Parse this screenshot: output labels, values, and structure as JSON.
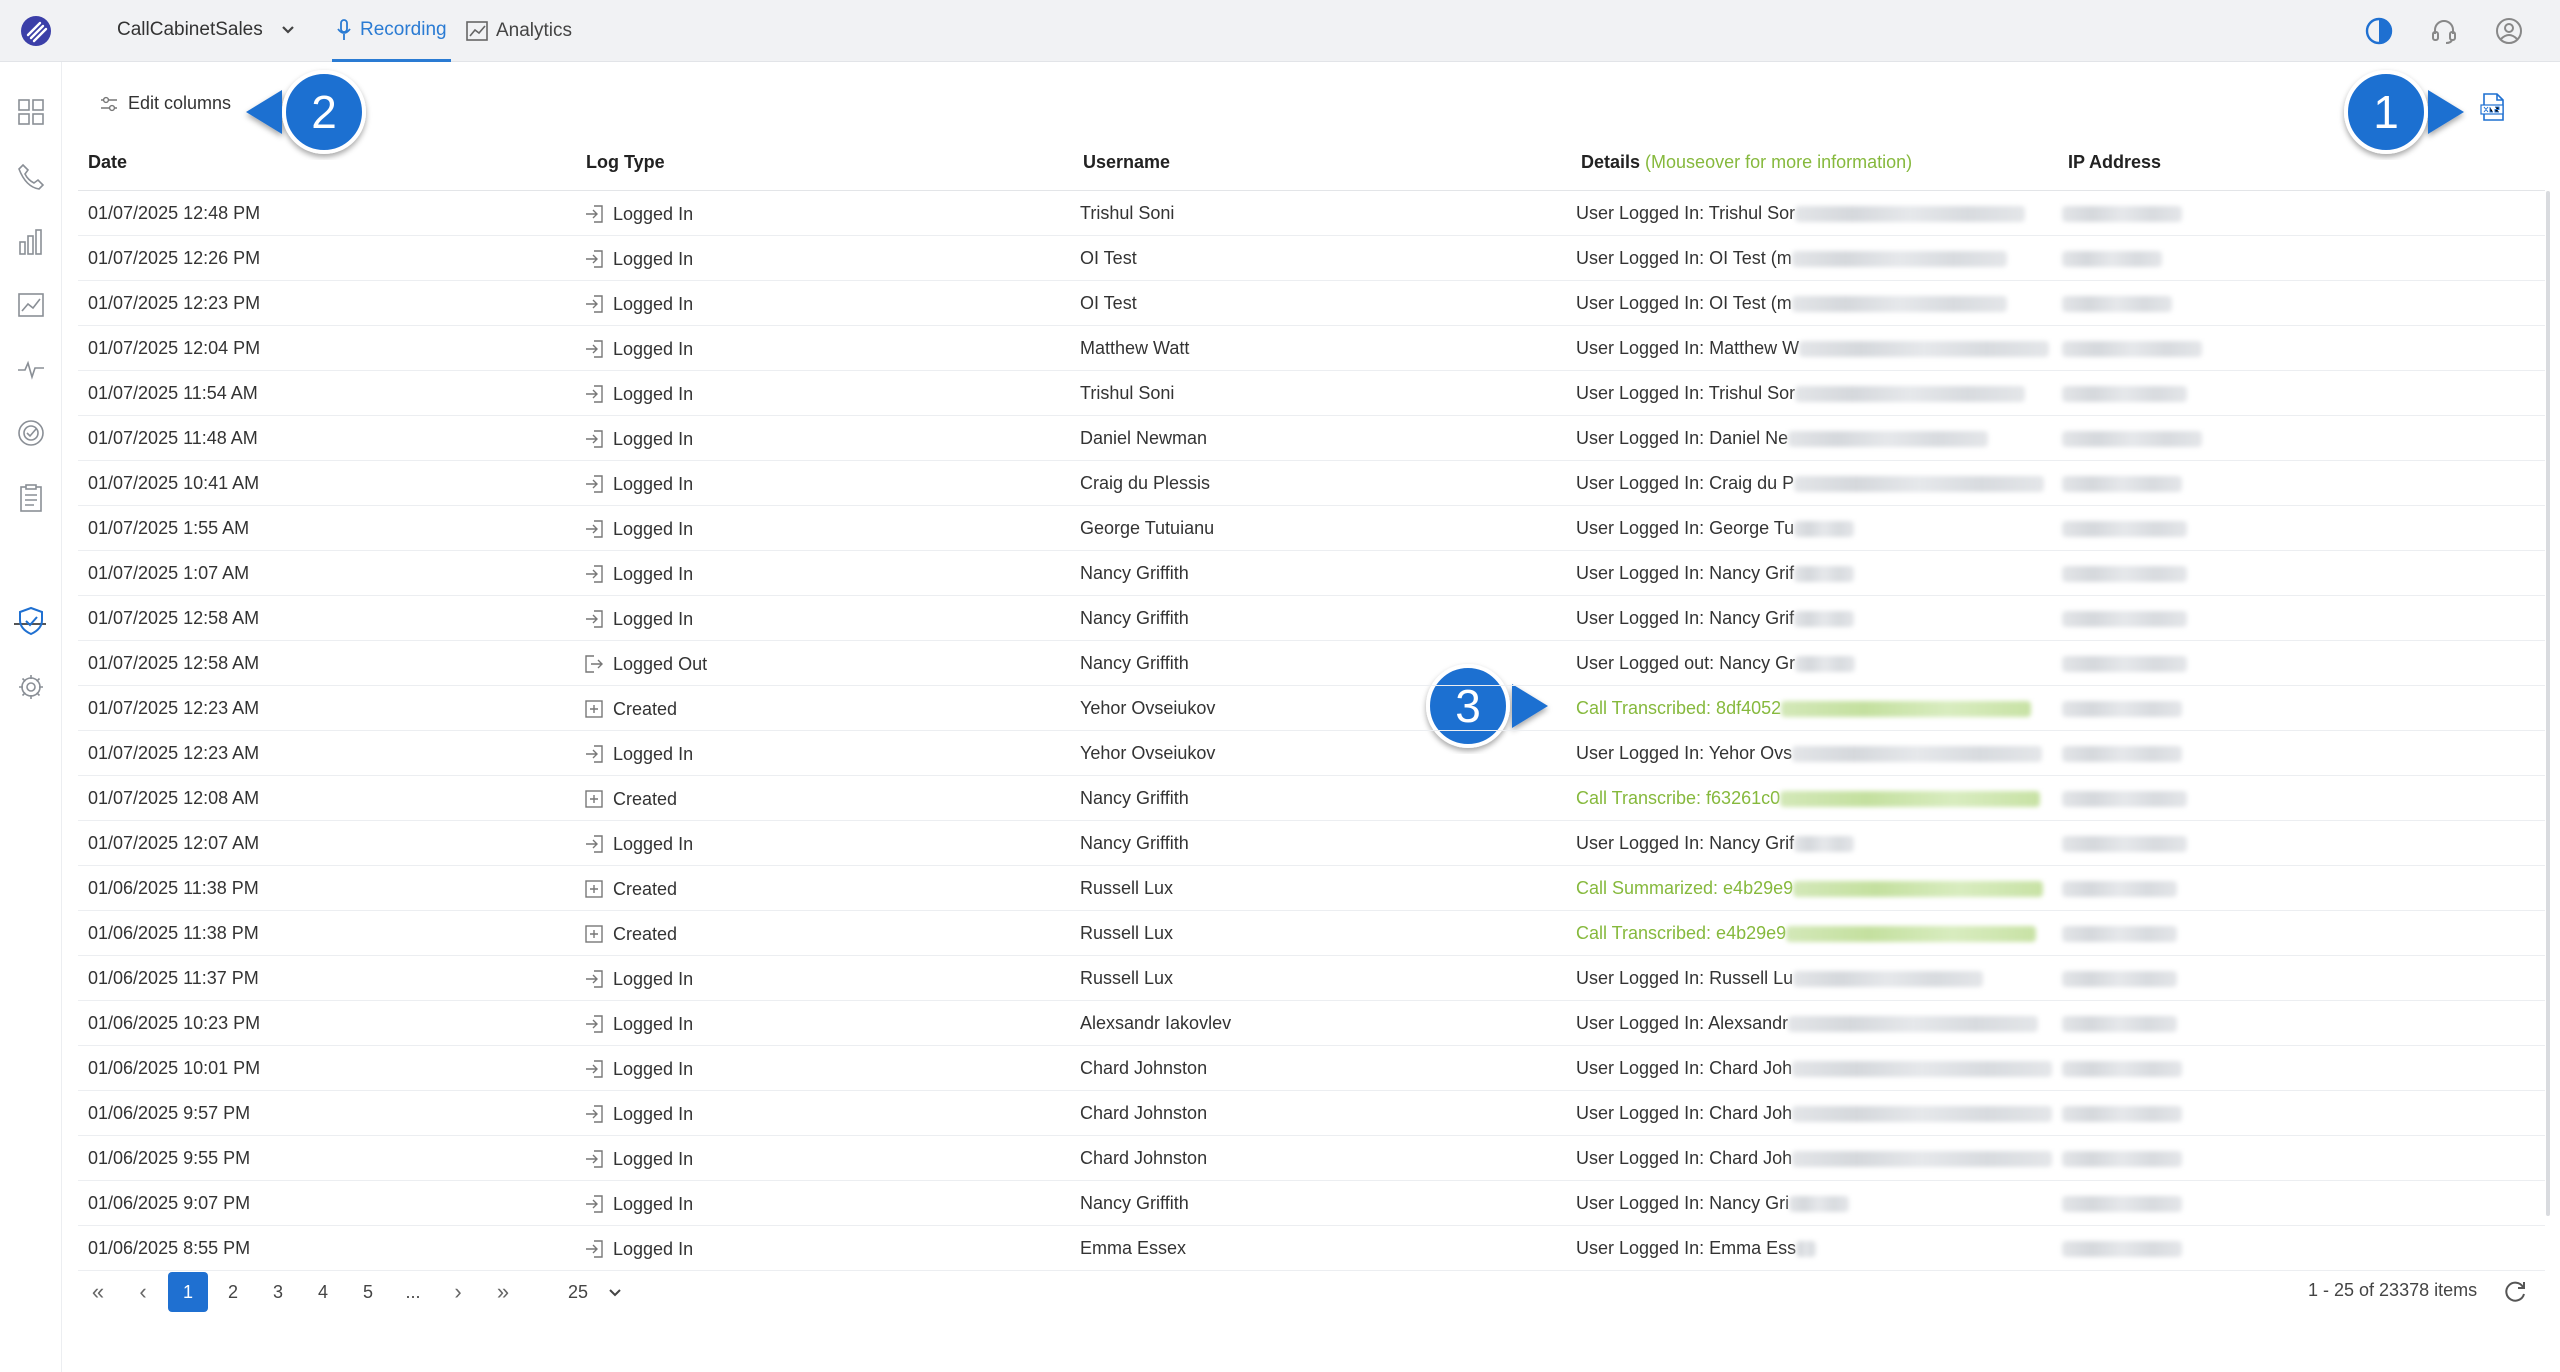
{
  "app": {
    "workspace": "CallCabinetSales",
    "tabs": [
      {
        "label": "Recording",
        "icon": "microphone-icon",
        "active": true
      },
      {
        "label": "Analytics",
        "icon": "analytics-chart-icon",
        "active": false
      }
    ],
    "accent": "#2a7bd3"
  },
  "toolbar": {
    "edit_columns_label": "Edit columns"
  },
  "markers": [
    "1",
    "2",
    "3"
  ],
  "table": {
    "columns": {
      "date": "Date",
      "log_type": "Log Type",
      "username": "Username",
      "details": "Details",
      "details_hint": "(Mouseover for more information)",
      "ip": "IP Address"
    },
    "rows": [
      {
        "date": "01/07/2025 12:48 PM",
        "type": "Logged In",
        "icon": "login-icon",
        "user": "Trishul Soni",
        "details": "User Logged In: Trishul Sor"
      },
      {
        "date": "01/07/2025 12:26 PM",
        "type": "Logged In",
        "icon": "login-icon",
        "user": "OI Test",
        "details": "User Logged In: OI Test (m"
      },
      {
        "date": "01/07/2025 12:23 PM",
        "type": "Logged In",
        "icon": "login-icon",
        "user": "OI Test",
        "details": "User Logged In: OI Test (m"
      },
      {
        "date": "01/07/2025 12:04 PM",
        "type": "Logged In",
        "icon": "login-icon",
        "user": "Matthew Watt",
        "details": "User Logged In: Matthew W"
      },
      {
        "date": "01/07/2025 11:54 AM",
        "type": "Logged In",
        "icon": "login-icon",
        "user": "Trishul Soni",
        "details": "User Logged In: Trishul Sor"
      },
      {
        "date": "01/07/2025 11:48 AM",
        "type": "Logged In",
        "icon": "login-icon",
        "user": "Daniel Newman",
        "details": "User Logged In: Daniel Ne"
      },
      {
        "date": "01/07/2025 10:41 AM",
        "type": "Logged In",
        "icon": "login-icon",
        "user": "Craig du Plessis",
        "details": "User Logged In: Craig du P"
      },
      {
        "date": "01/07/2025 1:55 AM",
        "type": "Logged In",
        "icon": "login-icon",
        "user": "George Tutuianu",
        "details": "User Logged In: George Tu"
      },
      {
        "date": "01/07/2025 1:07 AM",
        "type": "Logged In",
        "icon": "login-icon",
        "user": "Nancy Griffith",
        "details": "User Logged In: Nancy Grif"
      },
      {
        "date": "01/07/2025 12:58 AM",
        "type": "Logged In",
        "icon": "login-icon",
        "user": "Nancy Griffith",
        "details": "User Logged In: Nancy Grif"
      },
      {
        "date": "01/07/2025 12:58 AM",
        "type": "Logged Out",
        "icon": "logout-icon",
        "user": "Nancy Griffith",
        "details": "User Logged out: Nancy Gr"
      },
      {
        "date": "01/07/2025 12:23 AM",
        "type": "Created",
        "icon": "plus-square-icon",
        "user": "Yehor Ovseiukov",
        "details": "Call Transcribed: 8df4052",
        "highlight": true
      },
      {
        "date": "01/07/2025 12:23 AM",
        "type": "Logged In",
        "icon": "login-icon",
        "user": "Yehor Ovseiukov",
        "details": "User Logged In: Yehor Ovs"
      },
      {
        "date": "01/07/2025 12:08 AM",
        "type": "Created",
        "icon": "plus-square-icon",
        "user": "Nancy Griffith",
        "details": "Call Transcribe: f63261c0",
        "highlight": true
      },
      {
        "date": "01/07/2025 12:07 AM",
        "type": "Logged In",
        "icon": "login-icon",
        "user": "Nancy Griffith",
        "details": "User Logged In: Nancy Grif"
      },
      {
        "date": "01/06/2025 11:38 PM",
        "type": "Created",
        "icon": "plus-square-icon",
        "user": "Russell Lux",
        "details": "Call Summarized: e4b29e9",
        "highlight": true
      },
      {
        "date": "01/06/2025 11:38 PM",
        "type": "Created",
        "icon": "plus-square-icon",
        "user": "Russell Lux",
        "details": "Call Transcribed: e4b29e9",
        "highlight": true
      },
      {
        "date": "01/06/2025 11:37 PM",
        "type": "Logged In",
        "icon": "login-icon",
        "user": "Russell Lux",
        "details": "User Logged In: Russell Lu"
      },
      {
        "date": "01/06/2025 10:23 PM",
        "type": "Logged In",
        "icon": "login-icon",
        "user": "Alexsandr Iakovlev",
        "details": "User Logged In: Alexsandr"
      },
      {
        "date": "01/06/2025 10:01 PM",
        "type": "Logged In",
        "icon": "login-icon",
        "user": "Chard Johnston",
        "details": "User Logged In: Chard Joh"
      },
      {
        "date": "01/06/2025 9:57 PM",
        "type": "Logged In",
        "icon": "login-icon",
        "user": "Chard Johnston",
        "details": "User Logged In: Chard Joh"
      },
      {
        "date": "01/06/2025 9:55 PM",
        "type": "Logged In",
        "icon": "login-icon",
        "user": "Chard Johnston",
        "details": "User Logged In: Chard Joh"
      },
      {
        "date": "01/06/2025 9:07 PM",
        "type": "Logged In",
        "icon": "login-icon",
        "user": "Nancy Griffith",
        "details": "User Logged In: Nancy Gri"
      },
      {
        "date": "01/06/2025 8:55 PM",
        "type": "Logged In",
        "icon": "login-icon",
        "user": "Emma Essex",
        "details": "User Logged In: Emma Ess"
      }
    ]
  },
  "pagination": {
    "first": "«",
    "prev": "‹",
    "pages": [
      "1",
      "2",
      "3",
      "4",
      "5",
      "..."
    ],
    "current": "1",
    "next": "›",
    "last": "»",
    "page_size": "25",
    "summary": "1 - 25 of 23378 items"
  },
  "colors": {
    "highlight_text": "#86b93d",
    "marker": "#1f70d1",
    "active_page": "#1f70d1"
  }
}
